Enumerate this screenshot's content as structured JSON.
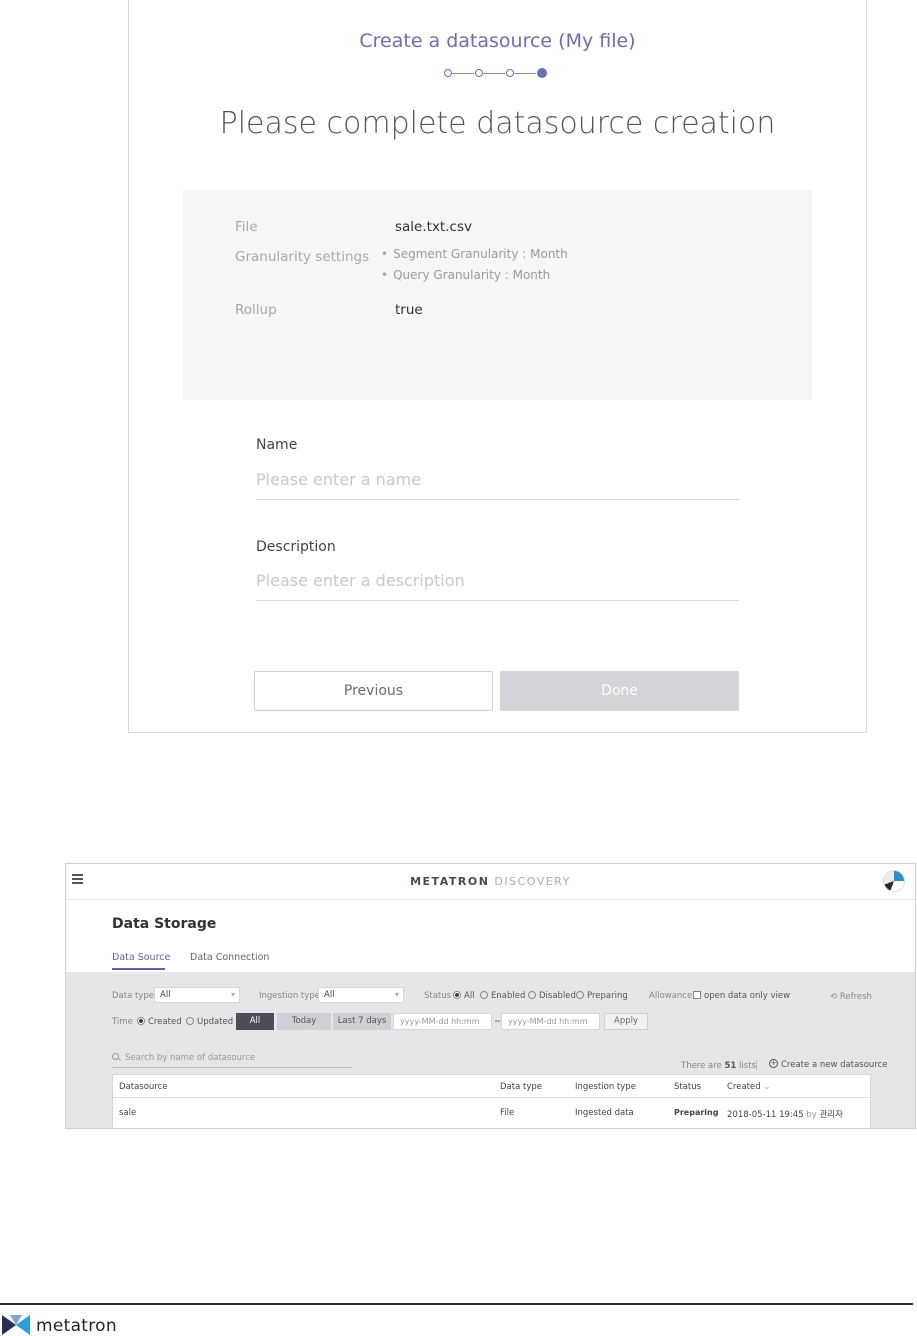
{
  "wizard": {
    "title": "Create a datasource (My file)",
    "heading": "Please complete datasource creation",
    "summary": {
      "file_label": "File",
      "file_value": "sale.txt.csv",
      "granularity_label": "Granularity settings",
      "segment_granularity": "Segment Granularity : Month",
      "query_granularity": "Query Granularity : Month",
      "rollup_label": "Rollup",
      "rollup_value": "true"
    },
    "name_label": "Name",
    "name_placeholder": "Please enter a name",
    "description_label": "Description",
    "description_placeholder": "Please enter a description",
    "previous_label": "Previous",
    "done_label": "Done",
    "steps_total": 4,
    "steps_current": 4
  },
  "app": {
    "brand_main": "METATRON",
    "brand_sub": "DISCOVERY",
    "page_title": "Data Storage",
    "tabs": [
      {
        "label": "Data Source",
        "active": true
      },
      {
        "label": "Data Connection",
        "active": false
      }
    ],
    "filters": {
      "data_type_label": "Data type",
      "data_type_value": "All",
      "ingestion_type_label": "Ingestion type",
      "ingestion_type_value": "All",
      "status_label": "Status",
      "status_options": [
        "All",
        "Enabled",
        "Disabled",
        "Preparing"
      ],
      "allowance_label": "Allowance",
      "allowance_option": "open data only view",
      "refresh_label": "Refresh",
      "time_label": "Time",
      "time_options": [
        "Created",
        "Updated"
      ],
      "time_buttons": [
        "All",
        "Today",
        "Last 7 days"
      ],
      "date_from_placeholder": "yyyy-MM-dd hh:mm",
      "date_separator": "~",
      "date_to_placeholder": "yyyy-MM-dd hh:mm",
      "apply_label": "Apply"
    },
    "search_placeholder": "Search by name of datasource",
    "list_count_prefix": "There are",
    "list_count": "51",
    "list_count_suffix": "lists",
    "create_label": "Create a new datasource",
    "table": {
      "columns": [
        "Datasource",
        "Data type",
        "Ingestion type",
        "Status",
        "Created"
      ],
      "sort_indicator": "⌄",
      "rows": [
        {
          "datasource": "sale",
          "data_type": "File",
          "ingestion_type": "Ingested data",
          "status": "Preparing",
          "created": "2018-05-11 19:45",
          "by_label": "by",
          "by_user": "관리자"
        }
      ]
    }
  },
  "footer": {
    "logo_text": "metatron",
    "line_color": "#232c4c",
    "accent_color": "#5d62a8"
  }
}
